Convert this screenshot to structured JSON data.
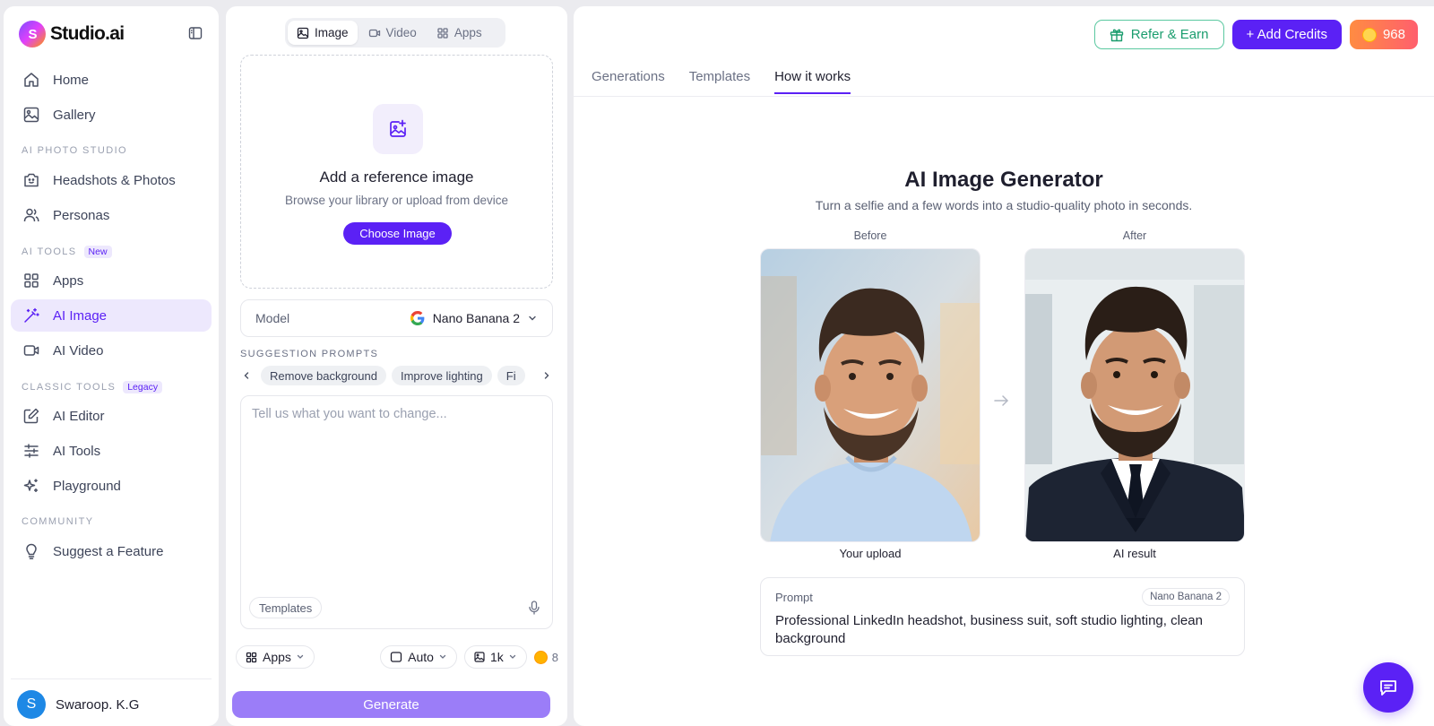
{
  "app": {
    "name": "Studio.ai"
  },
  "sidebar": {
    "items": [
      {
        "label": "Home",
        "icon": "home-icon"
      },
      {
        "label": "Gallery",
        "icon": "image-icon"
      },
      {
        "label": "Headshots & Photos",
        "icon": "camera-face-icon"
      },
      {
        "label": "Personas",
        "icon": "users-icon"
      },
      {
        "label": "Apps",
        "icon": "grid-icon"
      },
      {
        "label": "AI Image",
        "icon": "magic-wand-icon",
        "active": true
      },
      {
        "label": "AI Video",
        "icon": "video-icon"
      },
      {
        "label": "AI Editor",
        "icon": "edit-icon"
      },
      {
        "label": "AI Tools",
        "icon": "sliders-icon"
      },
      {
        "label": "Playground",
        "icon": "sparkles-icon"
      },
      {
        "label": "Suggest a Feature",
        "icon": "lightbulb-icon"
      }
    ],
    "sections": {
      "photo_studio": "AI PHOTO STUDIO",
      "tools": "AI TOOLS",
      "tools_tag": "New",
      "classic": "CLASSIC TOOLS",
      "classic_tag": "Legacy",
      "community": "COMMUNITY"
    },
    "user": {
      "initial": "S",
      "name": "Swaroop. K.G"
    }
  },
  "composer": {
    "modes": [
      "Image",
      "Video",
      "Apps"
    ],
    "active_mode": "Image",
    "dropzone": {
      "title": "Add a reference image",
      "subtitle": "Browse your library or upload from device",
      "button": "Choose Image"
    },
    "model": {
      "label": "Model",
      "value": "Nano Banana 2"
    },
    "suggestions": {
      "label": "SUGGESTION PROMPTS",
      "chips": [
        "Remove background",
        "Improve lighting",
        "Fi"
      ]
    },
    "prompt_placeholder": "Tell us what you want to change...",
    "templates_label": "Templates",
    "apps_label": "Apps",
    "aspect": "Auto",
    "resolution": "1k",
    "cost": "8",
    "generate_label": "Generate"
  },
  "header": {
    "refer": "Refer & Earn",
    "add_credits": "+ Add Credits",
    "credits": "968"
  },
  "tabs": [
    "Generations",
    "Templates",
    "How it works"
  ],
  "active_tab": "How it works",
  "hero": {
    "title": "AI Image Generator",
    "subtitle": "Turn a selfie and a few words into a studio-quality photo in seconds.",
    "before_label": "Before",
    "after_label": "After",
    "before_caption": "Your upload",
    "after_caption": "AI result",
    "prompt_label": "Prompt",
    "prompt_model": "Nano Banana 2",
    "prompt_text": "Professional LinkedIn headshot, business suit, soft studio lighting, clean background"
  },
  "colors": {
    "accent": "#5b21f5",
    "accent_light": "#ede8fd",
    "refer_green": "#1b9d6e",
    "credit_gradient": [
      "#ff8c42",
      "#ff5f6d"
    ]
  }
}
